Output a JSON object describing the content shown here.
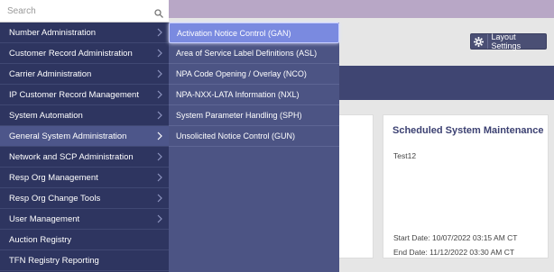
{
  "search": {
    "placeholder": "Search"
  },
  "menu": {
    "items": [
      {
        "label": "Number Administration",
        "has_submenu": true
      },
      {
        "label": "Customer Record Administration",
        "has_submenu": true
      },
      {
        "label": "Carrier Administration",
        "has_submenu": true
      },
      {
        "label": "IP Customer Record Management",
        "has_submenu": true
      },
      {
        "label": "System Automation",
        "has_submenu": true
      },
      {
        "label": "General System Administration",
        "has_submenu": true
      },
      {
        "label": "Network and SCP Administration",
        "has_submenu": true
      },
      {
        "label": "Resp Org Management",
        "has_submenu": true
      },
      {
        "label": "Resp Org Change Tools",
        "has_submenu": true
      },
      {
        "label": "User Management",
        "has_submenu": true
      },
      {
        "label": "Auction Registry",
        "has_submenu": false
      },
      {
        "label": "TFN Registry Reporting",
        "has_submenu": false
      }
    ]
  },
  "submenu": {
    "items": [
      {
        "label": "Activation Notice Control (GAN)"
      },
      {
        "label": "Area of Service Label Definitions (ASL)"
      },
      {
        "label": "NPA Code Opening / Overlay (NCO)"
      },
      {
        "label": "NPA-NXX-LATA Information (NXL)"
      },
      {
        "label": "System Parameter Handling (SPH)"
      },
      {
        "label": "Unsolicited Notice Control (GUN)"
      }
    ]
  },
  "toolbar": {
    "layout_settings_label": "Layout Settings"
  },
  "card": {
    "title": "Scheduled System Maintenance",
    "body": "Test12",
    "start": "Start Date: 10/07/2022 03:15 AM CT",
    "end": "End Date: 11/12/2022 03:30 AM CT"
  },
  "colors": {
    "menu_bg": "#2e3560",
    "submenu_bg": "#4c5484",
    "highlight": "#7a8ae0"
  }
}
